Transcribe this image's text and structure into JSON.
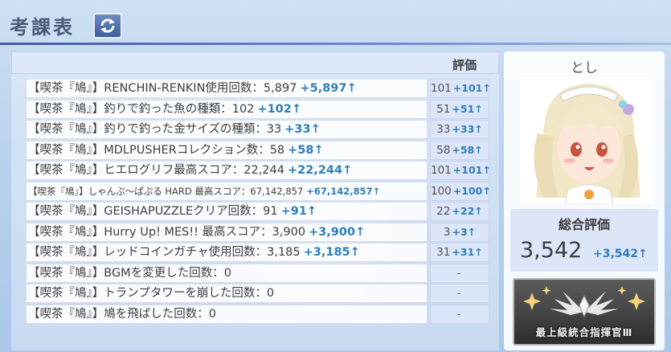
{
  "header": {
    "title": "考課表"
  },
  "table": {
    "score_header": "評価"
  },
  "rows": [
    {
      "label": "【喫茶『鳩』】RENCHIN-RENKIN使用回数：5,897",
      "delta": "+5,897↑",
      "score": "101",
      "score_delta": "+101↑",
      "small": false
    },
    {
      "label": "【喫茶『鳩』】釣りで釣った魚の種類：102",
      "delta": "+102↑",
      "score": "51",
      "score_delta": "+51↑",
      "small": false
    },
    {
      "label": "【喫茶『鳩』】釣りで釣った金サイズの種類：33",
      "delta": "+33↑",
      "score": "33",
      "score_delta": "+33↑",
      "small": false
    },
    {
      "label": "【喫茶『鳩』】MDLPUSHERコレクション数：58",
      "delta": "+58↑",
      "score": "58",
      "score_delta": "+58↑",
      "small": false
    },
    {
      "label": "【喫茶『鳩』】ヒエログリフ最高スコア：22,244",
      "delta": "+22,244↑",
      "score": "101",
      "score_delta": "+101↑",
      "small": false
    },
    {
      "label": "【喫茶『鳩』】しゃんぷ～ぱぷる HARD 最高スコア：67,142,857",
      "delta": "+67,142,857↑",
      "score": "100",
      "score_delta": "+100↑",
      "small": true
    },
    {
      "label": "【喫茶『鳩』】GEISHAPUZZLEクリア回数：91",
      "delta": "+91↑",
      "score": "22",
      "score_delta": "+22↑",
      "small": false
    },
    {
      "label": "【喫茶『鳩』】Hurry Up! MES!! 最高スコア：3,900",
      "delta": "+3,900↑",
      "score": "3",
      "score_delta": "+3↑",
      "small": false
    },
    {
      "label": "【喫茶『鳩』】レッドコインガチャ使用回数：3,185",
      "delta": "+3,185↑",
      "score": "31",
      "score_delta": "+31↑",
      "small": false
    },
    {
      "label": "【喫茶『鳩』】BGMを変更した回数：0",
      "delta": "",
      "score": "-",
      "score_delta": "",
      "small": false
    },
    {
      "label": "【喫茶『鳩』】トランプタワーを崩した回数：0",
      "delta": "",
      "score": "-",
      "score_delta": "",
      "small": false
    },
    {
      "label": "【喫茶『鳩』】鳩を飛ばした回数：0",
      "delta": "",
      "score": "-",
      "score_delta": "",
      "small": false
    }
  ],
  "profile": {
    "name": "とし",
    "summary_label": "総合評価",
    "summary_value": "3,542",
    "summary_delta": "+3,542↑",
    "rank_title": "最上級統合指揮官Ⅲ"
  },
  "colors": {
    "accent": "#2e7fb9",
    "header_line": "#3a5fa6"
  },
  "icons": {
    "refresh": "refresh-icon",
    "rank": "rank-emblem-icon"
  }
}
